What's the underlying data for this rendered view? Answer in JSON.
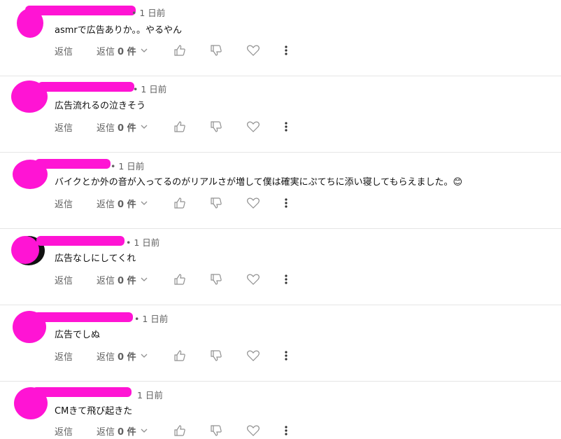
{
  "comments": [
    {
      "time": "• 1 日前",
      "text": "asmrで広告ありか。。やるやん",
      "reply": "返信",
      "replies_label": "返信",
      "replies_count": "0 件"
    },
    {
      "time": "• 1 日前",
      "text": "広告流れるの泣きそう",
      "reply": "返信",
      "replies_label": "返信",
      "replies_count": "0 件"
    },
    {
      "time": "• 1 日前",
      "text": "バイクとか外の音が入ってるのがリアルさが増して僕は確実にぷてちに添い寝してもらえました。😊",
      "reply": "返信",
      "replies_label": "返信",
      "replies_count": "0 件"
    },
    {
      "time": "• 1 日前",
      "text": "広告なしにしてくれ",
      "reply": "返信",
      "replies_label": "返信",
      "replies_count": "0 件"
    },
    {
      "time": "• 1 日前",
      "text": "広告でしぬ",
      "reply": "返信",
      "replies_label": "返信",
      "replies_count": "0 件"
    },
    {
      "time": "1 日前",
      "text": "CMきて飛び起きた",
      "reply": "返信",
      "replies_label": "返信",
      "replies_count": "0 件"
    }
  ],
  "icons": {
    "like": "thumb-up-icon",
    "dislike": "thumb-down-icon",
    "heart": "heart-icon",
    "more": "more-vert-icon",
    "chevron": "chevron-down-icon"
  },
  "colors": {
    "redaction": "#ff14d4",
    "meta_text": "#606060",
    "divider": "#e5e5e5"
  }
}
